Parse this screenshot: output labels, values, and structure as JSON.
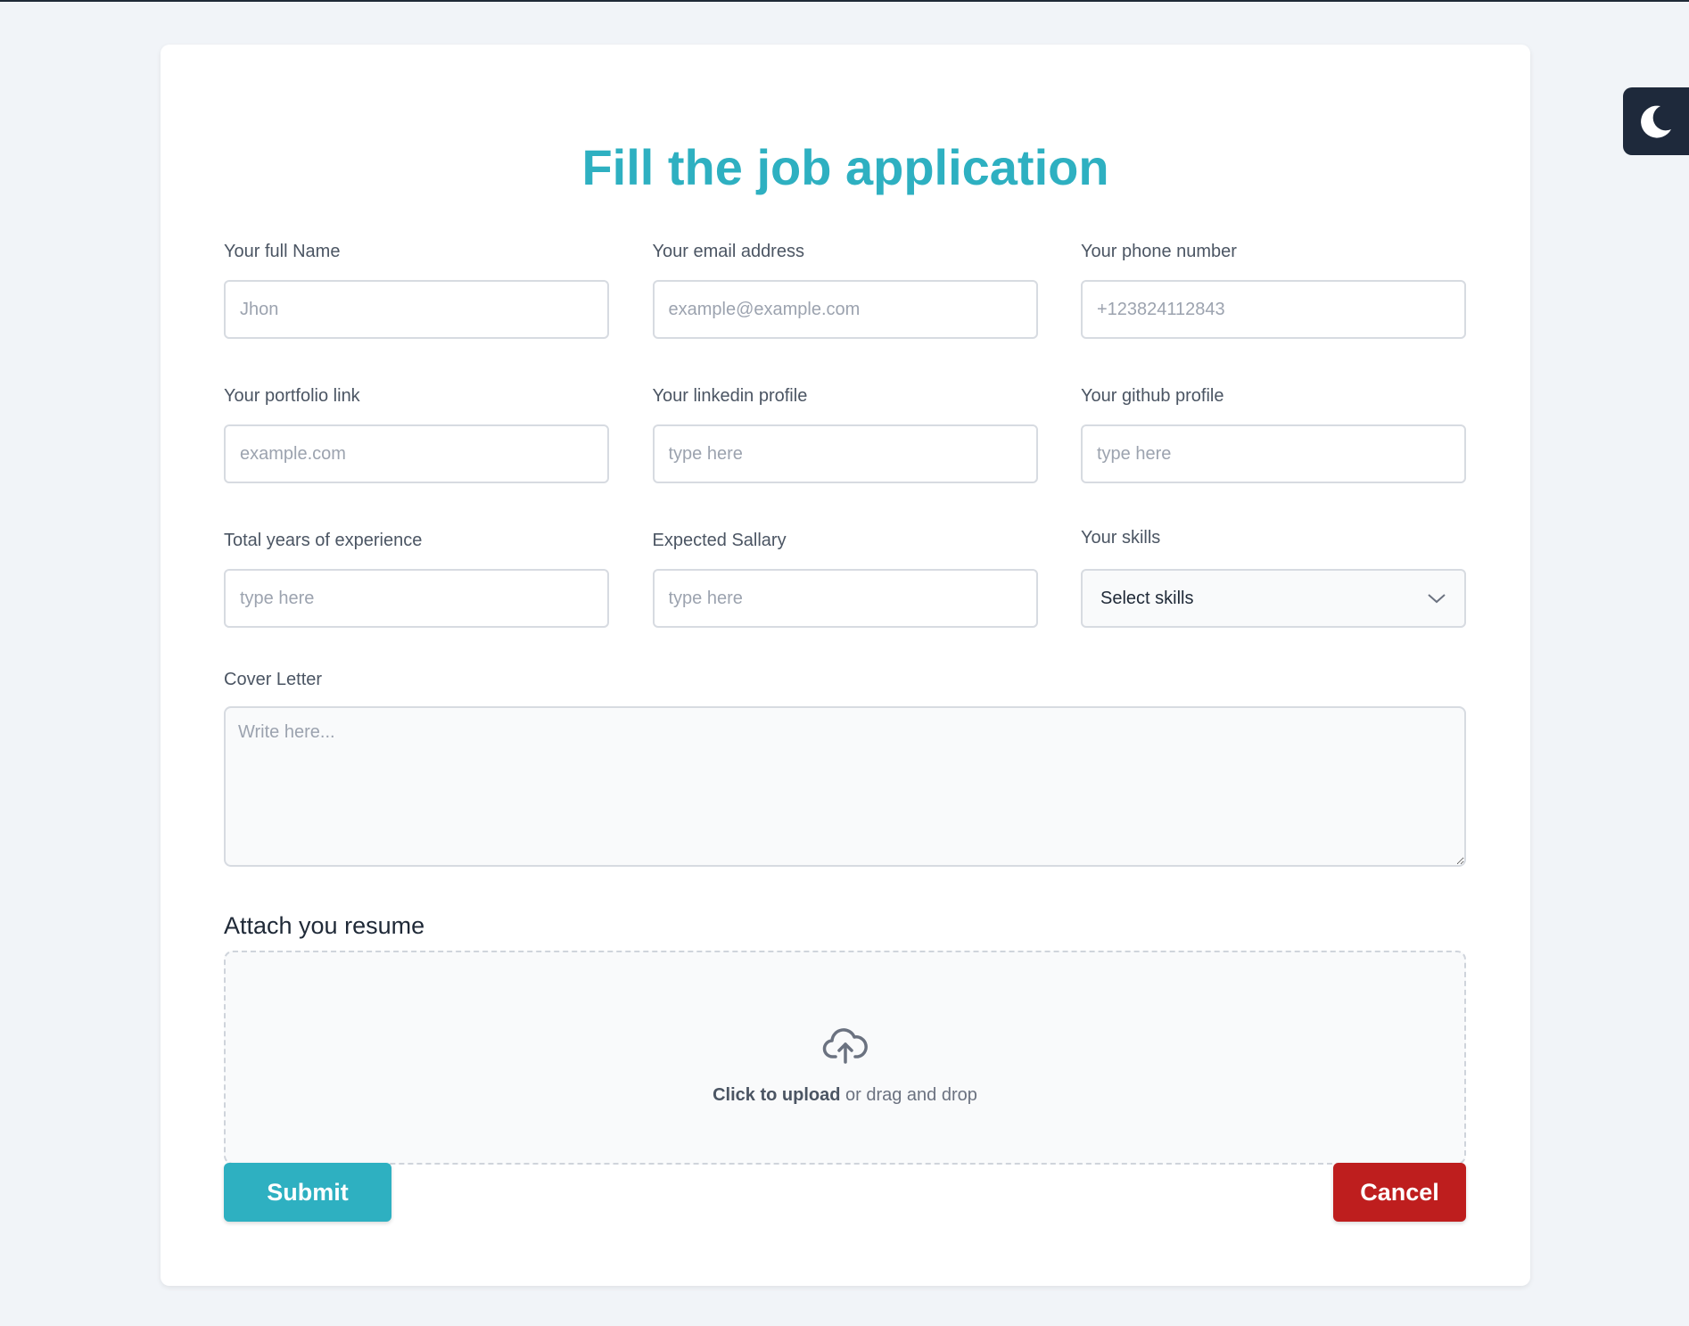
{
  "page": {
    "title": "Fill the job application"
  },
  "fields": {
    "full_name": {
      "label": "Your full Name",
      "placeholder": "Jhon"
    },
    "email": {
      "label": "Your email address",
      "placeholder": "example@example.com"
    },
    "phone": {
      "label": "Your phone number",
      "placeholder": "+123824112843"
    },
    "portfolio": {
      "label": "Your portfolio link",
      "placeholder": "example.com"
    },
    "linkedin": {
      "label": "Your linkedin profile",
      "placeholder": "type here"
    },
    "github": {
      "label": "Your github profile",
      "placeholder": "type here"
    },
    "experience": {
      "label": "Total years of experience",
      "placeholder": "type here"
    },
    "salary": {
      "label": "Expected Sallary",
      "placeholder": "type here"
    },
    "skills": {
      "label": "Your skills",
      "selected": "Select skills"
    }
  },
  "cover_letter": {
    "label": "Cover Letter",
    "placeholder": "Write here..."
  },
  "resume": {
    "label": "Attach you resume",
    "upload_strong": "Click to upload",
    "upload_rest": " or drag and drop"
  },
  "actions": {
    "submit": "Submit",
    "cancel": "Cancel"
  },
  "icons": {
    "theme_toggle": "moon-icon",
    "upload": "cloud-upload-icon",
    "dropdown": "chevron-down-icon"
  },
  "colors": {
    "accent": "#2eb0c1",
    "cancel": "#be1e1e",
    "toggle_bg": "#1e293b"
  }
}
